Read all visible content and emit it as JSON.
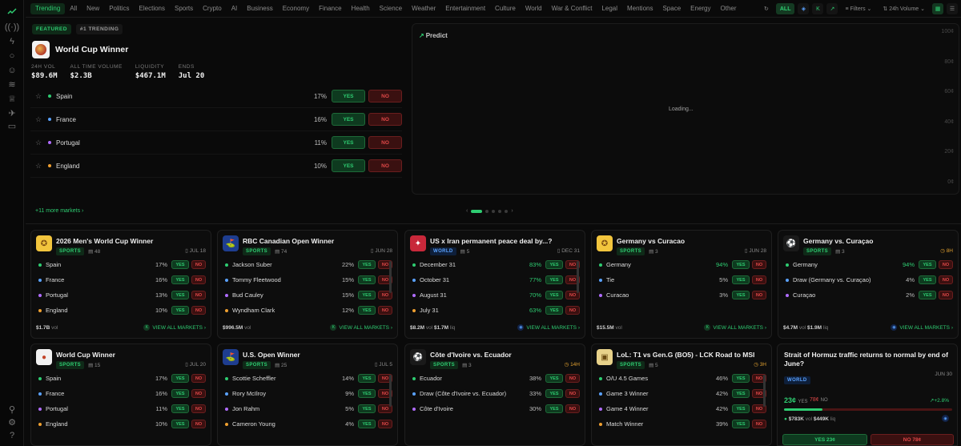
{
  "nav": {
    "categories": [
      "Trending",
      "All",
      "New",
      "Politics",
      "Elections",
      "Sports",
      "Crypto",
      "AI",
      "Business",
      "Economy",
      "Finance",
      "Health",
      "Science",
      "Weather",
      "Entertainment",
      "Culture",
      "World",
      "War & Conflict",
      "Legal",
      "Mentions",
      "Space",
      "Energy",
      "Other"
    ],
    "active": "Trending",
    "all_label": "ALL",
    "filters_label": "Filters",
    "sort_label": "24h Volume"
  },
  "featured": {
    "badge1": "FEATURED",
    "badge2": "#1 TRENDING",
    "title": "World Cup Winner",
    "stats": [
      {
        "label": "24H VOL",
        "value": "$89.6M"
      },
      {
        "label": "ALL TIME VOLUME",
        "value": "$2.3B"
      },
      {
        "label": "LIQUIDITY",
        "value": "$467.1M"
      },
      {
        "label": "ENDS",
        "value": "Jul 20"
      }
    ],
    "markets": [
      {
        "name": "Spain",
        "pct": "17%",
        "color": "#2ecc71"
      },
      {
        "name": "France",
        "pct": "16%",
        "color": "#5aa2ff"
      },
      {
        "name": "Portugal",
        "pct": "11%",
        "color": "#b06cff"
      },
      {
        "name": "England",
        "pct": "10%",
        "color": "#f0a030"
      }
    ],
    "yes": "YES",
    "no": "NO",
    "more": "+11 more markets ›"
  },
  "chart": {
    "brand": "Predict",
    "loading": "Loading...",
    "y_ticks": [
      "100¢",
      "80¢",
      "60¢",
      "40¢",
      "20¢",
      "0¢"
    ]
  },
  "cards": [
    {
      "title": "2026 Men's World Cup Winner",
      "tag": "SPORTS",
      "count": "48",
      "date": "JUL 18",
      "logo": "trophy",
      "rows": [
        {
          "n": "Spain",
          "p": "17%",
          "c": "#2ecc71"
        },
        {
          "n": "France",
          "p": "16%",
          "c": "#5aa2ff"
        },
        {
          "n": "Portugal",
          "p": "13%",
          "c": "#b06cff"
        },
        {
          "n": "England",
          "p": "10%",
          "c": "#f0a030"
        }
      ],
      "vol": "$1.7B",
      "liq": "",
      "va": "VIEW ALL MARKETS ›"
    },
    {
      "title": "RBC Canadian Open Winner",
      "tag": "SPORTS",
      "count": "74",
      "date": "JUN 28",
      "logo": "golf",
      "rows": [
        {
          "n": "Jackson Suber",
          "p": "22%",
          "c": "#2ecc71"
        },
        {
          "n": "Tommy Fleetwood",
          "p": "15%",
          "c": "#5aa2ff"
        },
        {
          "n": "Bud Cauley",
          "p": "15%",
          "c": "#b06cff"
        },
        {
          "n": "Wyndham Clark",
          "p": "12%",
          "c": "#f0a030"
        }
      ],
      "vol": "$996.5M",
      "liq": "",
      "va": "VIEW ALL MARKETS ›"
    },
    {
      "title": "US x Iran permanent peace deal by...?",
      "tag": "WORLD",
      "count": "5",
      "date": "DEC 31",
      "logo": "flag",
      "rows": [
        {
          "n": "December 31",
          "p": "83%",
          "c": "#2ecc71"
        },
        {
          "n": "October 31",
          "p": "77%",
          "c": "#5aa2ff"
        },
        {
          "n": "August 31",
          "p": "70%",
          "c": "#b06cff"
        },
        {
          "n": "July 31",
          "p": "63%",
          "c": "#f0a030"
        }
      ],
      "vol": "$8.2M",
      "liq": "$1.7M",
      "va": "VIEW ALL MARKETS ›"
    },
    {
      "title": "Germany vs Curacao",
      "tag": "SPORTS",
      "count": "3",
      "date": "JUN 28",
      "logo": "trophy",
      "rows": [
        {
          "n": "Germany",
          "p": "94%",
          "c": "#2ecc71"
        },
        {
          "n": "Tie",
          "p": "5%",
          "c": "#5aa2ff"
        },
        {
          "n": "Curacao",
          "p": "3%",
          "c": "#b06cff"
        }
      ],
      "vol": "$15.5M",
      "liq": "",
      "va": "VIEW ALL MARKETS ›"
    },
    {
      "title": "Germany vs. Curaçao",
      "tag": "SPORTS",
      "count": "3",
      "date": "8H",
      "live": true,
      "logo": "ball",
      "rows": [
        {
          "n": "Germany",
          "p": "94%",
          "c": "#2ecc71"
        },
        {
          "n": "Draw (Germany vs. Curaçao)",
          "p": "4%",
          "c": "#5aa2ff"
        },
        {
          "n": "Curaçao",
          "p": "2%",
          "c": "#b06cff"
        }
      ],
      "vol": "$4.7M",
      "liq": "$1.9M",
      "va": "VIEW ALL MARKETS ›"
    },
    {
      "title": "World Cup Winner",
      "tag": "SPORTS",
      "count": "15",
      "date": "JUL 20",
      "logo": "cup",
      "rows": [
        {
          "n": "Spain",
          "p": "17%",
          "c": "#2ecc71"
        },
        {
          "n": "France",
          "p": "16%",
          "c": "#5aa2ff"
        },
        {
          "n": "Portugal",
          "p": "11%",
          "c": "#b06cff"
        },
        {
          "n": "England",
          "p": "10%",
          "c": "#f0a030"
        }
      ],
      "vol": "",
      "liq": "",
      "va": ""
    },
    {
      "title": "U.S. Open Winner",
      "tag": "SPORTS",
      "count": "25",
      "date": "JUL 5",
      "logo": "golf",
      "rows": [
        {
          "n": "Scottie Scheffler",
          "p": "14%",
          "c": "#2ecc71"
        },
        {
          "n": "Rory McIlroy",
          "p": "9%",
          "c": "#5aa2ff"
        },
        {
          "n": "Jon Rahm",
          "p": "5%",
          "c": "#b06cff"
        },
        {
          "n": "Cameron Young",
          "p": "4%",
          "c": "#f0a030"
        }
      ],
      "vol": "",
      "liq": "",
      "va": ""
    },
    {
      "title": "Côte d'Ivoire vs. Ecuador",
      "tag": "SPORTS",
      "count": "3",
      "date": "14H",
      "live": true,
      "logo": "ball",
      "rows": [
        {
          "n": "Ecuador",
          "p": "38%",
          "c": "#2ecc71"
        },
        {
          "n": "Draw (Côte d'Ivoire vs. Ecuador)",
          "p": "33%",
          "c": "#5aa2ff"
        },
        {
          "n": "Côte d'Ivoire",
          "p": "30%",
          "c": "#b06cff"
        }
      ],
      "vol": "",
      "liq": "",
      "va": ""
    },
    {
      "title": "LoL: T1 vs Gen.G (BO5) - LCK Road to MSI",
      "tag": "SPORTS",
      "count": "5",
      "date": "3H",
      "live": true,
      "logo": "lol",
      "rows": [
        {
          "n": "O/U 4.5 Games",
          "p": "46%",
          "c": "#2ecc71"
        },
        {
          "n": "Game 3 Winner",
          "p": "42%",
          "c": "#5aa2ff"
        },
        {
          "n": "Game 4 Winner",
          "p": "42%",
          "c": "#b06cff"
        },
        {
          "n": "Match Winner",
          "p": "39%",
          "c": "#f0a030"
        }
      ],
      "vol": "",
      "liq": "",
      "va": ""
    }
  ],
  "hormuz": {
    "title": "Strait of Hormuz traffic returns to normal by end of June?",
    "tag": "WORLD",
    "date": "JUN 30",
    "yes_price": "23¢",
    "yes_word": "YES",
    "no_price": "78¢",
    "no_word": "NO",
    "change": "+2.8%",
    "yes_fraction": 0.23,
    "vol": "$783K",
    "liq": "$449K",
    "btn_yes": "YES 23¢",
    "btn_no": "NO 78¢"
  }
}
